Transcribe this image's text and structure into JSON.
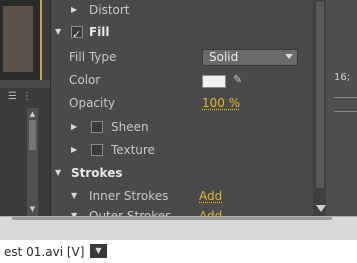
{
  "effects_panel": {
    "rows": {
      "distort": {
        "label": "Distort"
      },
      "fill": {
        "label": "Fill",
        "checked": true
      },
      "fill_type": {
        "label": "Fill Type",
        "value": "Solid"
      },
      "color": {
        "label": "Color",
        "swatch": "#f2f2f2"
      },
      "opacity": {
        "label": "Opacity",
        "value": "100 %"
      },
      "sheen": {
        "label": "Sheen",
        "checked": false
      },
      "texture": {
        "label": "Texture",
        "checked": false
      },
      "strokes": {
        "label": "Strokes"
      },
      "inner_strokes": {
        "label": "Inner Strokes",
        "action": "Add"
      },
      "outer_strokes": {
        "label": "Outer Strokes",
        "action": "Add"
      }
    }
  },
  "timeline": {
    "timecode": "16;"
  },
  "footer": {
    "file_tab": "est 01.avi [V]"
  },
  "colors": {
    "accent_link": "#e7b623",
    "panel_bg": "#4a4a4a",
    "swatch": "#f2f2f2"
  },
  "icons": [
    "triangle-right-icon",
    "triangle-down-icon",
    "checkbox-icon",
    "eyedropper-icon",
    "dropdown-caret-icon",
    "scroll-arrow-icon",
    "menu-icon"
  ]
}
